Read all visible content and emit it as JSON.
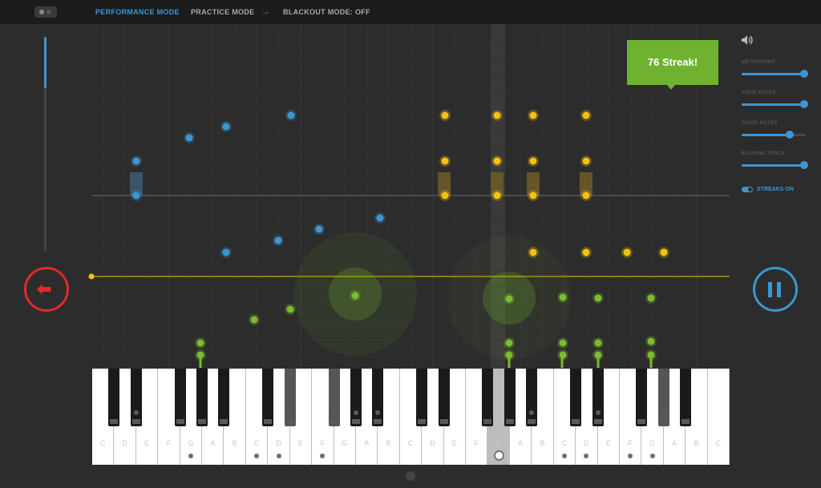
{
  "topbar": {
    "logo_icon": "camera-toggle-icon",
    "performance_mode": "PERFORMANCE MODE",
    "practice_mode": "PRACTICE MODE",
    "arrow_icon": "arrow-right-icon",
    "blackout_mode": "BLACKOUT MODE: OFF"
  },
  "streak": {
    "text": "76 Streak!"
  },
  "progress": {
    "fraction": 0.24
  },
  "controls": {
    "back_icon": "arrow-left-icon",
    "pause_icon": "pause-icon"
  },
  "right_panel": {
    "volume_icon": "speaker-icon",
    "sliders": [
      {
        "label": "METRONOME",
        "value": 0.98
      },
      {
        "label": "YOUR NOTES",
        "value": 0.98
      },
      {
        "label": "GUIDE NOTES",
        "value": 0.75
      },
      {
        "label": "BACKING TRACK",
        "value": 0.98
      }
    ],
    "streaks_toggle": {
      "label": "STREAKS ON",
      "on": true
    }
  },
  "keyboard": {
    "white_keys": [
      "C",
      "D",
      "E",
      "F",
      "G",
      "A",
      "B",
      "C",
      "D",
      "E",
      "F",
      "G",
      "A",
      "B",
      "C",
      "D",
      "E",
      "F",
      "G",
      "A",
      "B",
      "C",
      "D",
      "E",
      "F",
      "G",
      "A",
      "B",
      "C"
    ],
    "pressed_white": [
      18
    ],
    "white_dots": [
      4,
      7,
      8,
      10,
      18,
      21,
      22,
      24,
      25
    ],
    "black_pressed": [
      6,
      7,
      18
    ],
    "black_dots": [
      1,
      6,
      7,
      8,
      9,
      14,
      16,
      18,
      20,
      21,
      25,
      26
    ]
  },
  "colors": {
    "blue": "#3b97d3",
    "yellow": "#f6c20f",
    "green": "#7bbd2f",
    "red": "#e02a2a",
    "streak_bg": "#6fb22f"
  }
}
